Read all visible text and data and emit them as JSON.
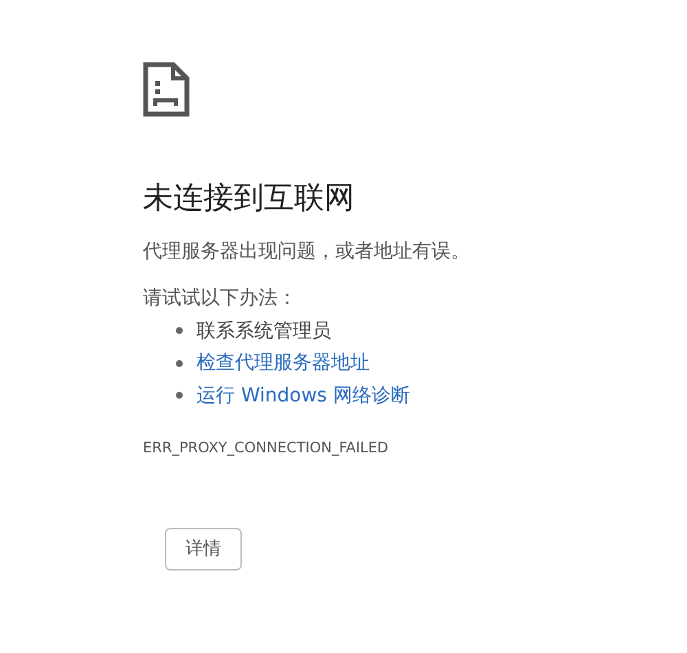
{
  "heading": "未连接到互联网",
  "message": "代理服务器出现问题，或者地址有误。",
  "suggestions": {
    "intro": "请试试以下办法：",
    "items": [
      {
        "kind": "text",
        "label": "联系系统管理员"
      },
      {
        "kind": "link",
        "label": "检查代理服务器地址"
      },
      {
        "kind": "link",
        "label": "运行 Windows 网络诊断"
      }
    ]
  },
  "error_code": "ERR_PROXY_CONNECTION_FAILED",
  "details_button": "详情"
}
